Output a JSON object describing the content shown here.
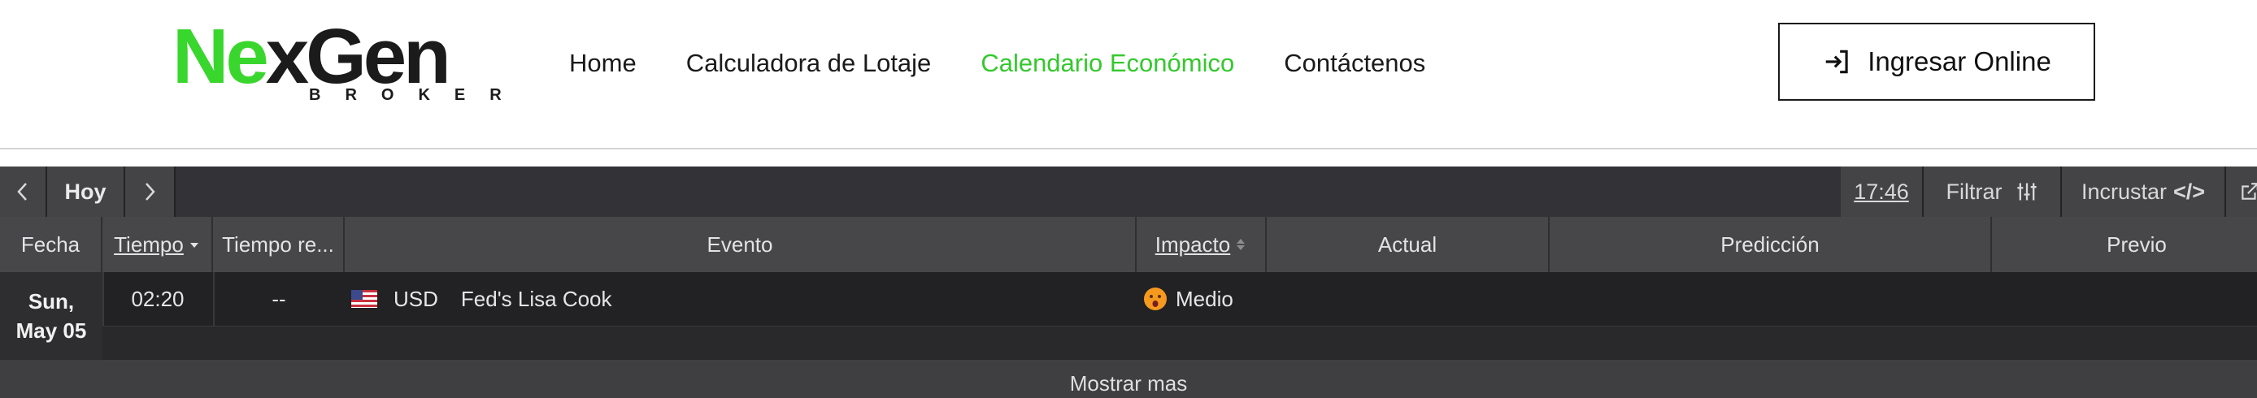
{
  "brand": {
    "logo_part1": "Ne",
    "logo_part2": "x",
    "logo_part3": "Gen",
    "logo_sub": "BROKER"
  },
  "nav": {
    "items": [
      {
        "label": "Home",
        "active": false
      },
      {
        "label": "Calculadora de Lotaje",
        "active": false
      },
      {
        "label": "Calendario Económico",
        "active": true
      },
      {
        "label": "Contáctenos",
        "active": false
      }
    ],
    "login_label": "Ingresar Online"
  },
  "toolbar": {
    "today_label": "Hoy",
    "time": "17:46",
    "filter_label": "Filtrar",
    "embed_label": "Incrustar",
    "embed_code": "</>"
  },
  "columns": {
    "date": "Fecha",
    "time": "Tiempo",
    "remaining": "Tiempo re...",
    "event": "Evento",
    "impact": "Impacto",
    "actual": "Actual",
    "forecast": "Predicción",
    "previous": "Previo"
  },
  "events": [
    {
      "date_line1": "Sun,",
      "date_line2": "May 05",
      "time": "02:20",
      "remaining": "--",
      "currency": "USD",
      "event": "Fed's Lisa Cook",
      "impact": "Medio",
      "actual": "",
      "forecast": "",
      "previous": ""
    }
  ],
  "show_more_label": "Mostrar mas",
  "colors": {
    "brand_green": "#39d62d",
    "active_nav": "#33c92c",
    "widget_bg": "#2b2a2d",
    "header_row_bg": "#474649"
  },
  "icons": {
    "login": "login-icon",
    "prev": "chevron-left-icon",
    "next": "chevron-right-icon",
    "filter": "sliders-icon",
    "external": "external-link-icon",
    "flag": "us-flag-icon",
    "impact": "surprised-face-icon"
  }
}
